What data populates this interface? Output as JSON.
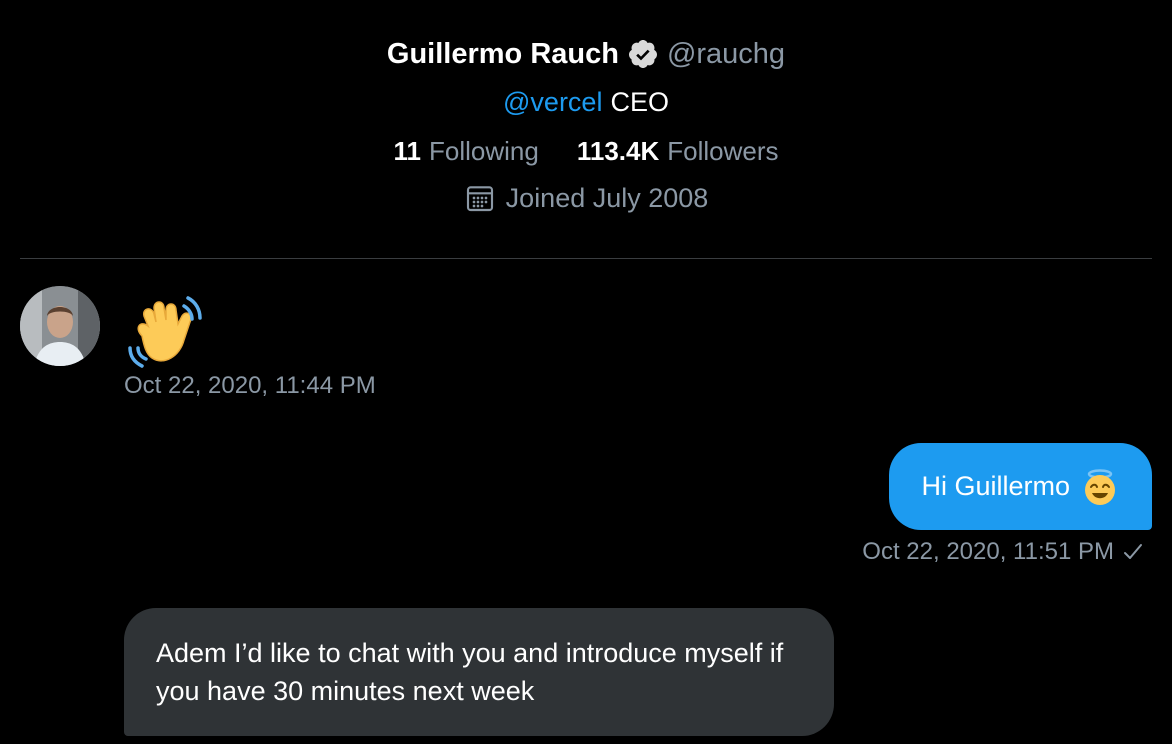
{
  "profile": {
    "display_name": "Guillermo Rauch",
    "handle": "@rauchg",
    "bio_mention": "@vercel",
    "bio_text": "CEO",
    "following_count": "11",
    "following_label": "Following",
    "followers_count": "113.4K",
    "followers_label": "Followers",
    "joined": "Joined July 2008"
  },
  "messages": [
    {
      "sender": "them",
      "content_icon": "waving-hand-emoji",
      "timestamp": "Oct 22, 2020, 11:44 PM"
    },
    {
      "sender": "me",
      "text": "Hi Guillermo",
      "emoji_icon": "smiling-face-with-halo-emoji",
      "timestamp": "Oct 22, 2020, 11:51 PM",
      "status_icon": "sent-check-icon"
    },
    {
      "sender": "them",
      "text": "Adem I’d like to chat with you and introduce myself if you have 30 minutes next week"
    }
  ],
  "colors": {
    "background": "#000000",
    "accent": "#1d9bf0",
    "muted": "#8b98a5",
    "incoming_bubble": "#2f3336"
  }
}
